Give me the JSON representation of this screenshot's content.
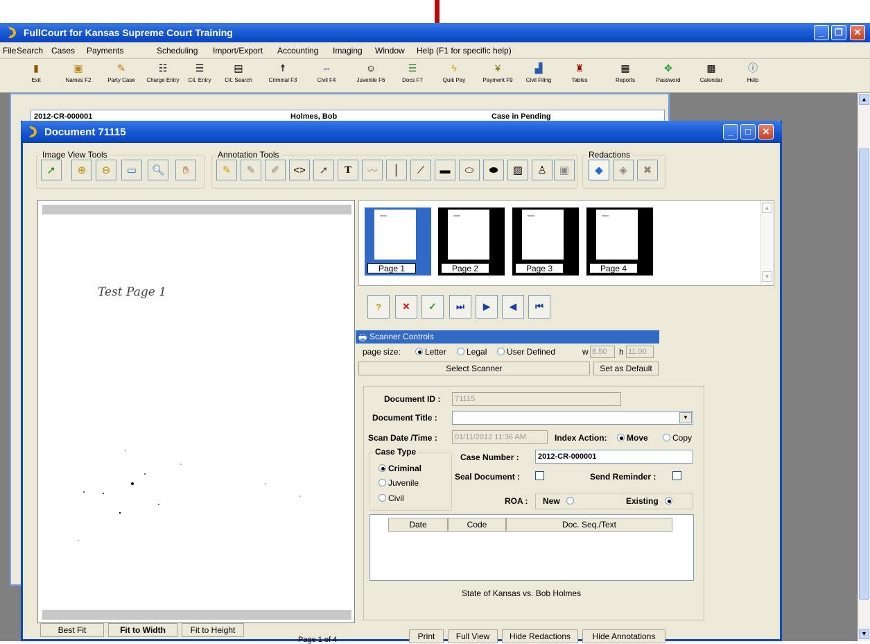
{
  "main_window": {
    "title": "FullCourt for Kansas Supreme Court Training",
    "controls": [
      "_",
      "❐",
      "✕"
    ]
  },
  "menu": {
    "items": [
      "File",
      "Search",
      "Cases",
      "Payments",
      "Scheduling",
      "Import/Export",
      "Accounting",
      "Imaging",
      "Window",
      "Help",
      "(F1 for specific help)"
    ]
  },
  "toolbar": {
    "items": [
      {
        "label": "Exit",
        "icon": "exit-icon"
      },
      {
        "label": "Names F2",
        "icon": "names-icon"
      },
      {
        "label": "Party Case",
        "icon": "party-case-icon"
      },
      {
        "label": "Charge Entry",
        "icon": "charge-entry-icon"
      },
      {
        "label": "Cit. Entry",
        "icon": "cit-entry-icon"
      },
      {
        "label": "Cit. Search",
        "icon": "cit-search-icon"
      },
      {
        "label": "Criminal F3",
        "icon": "criminal-icon"
      },
      {
        "label": "Civil F4",
        "icon": "civil-icon"
      },
      {
        "label": "Juvenile F6",
        "icon": "juvenile-icon"
      },
      {
        "label": "Docs F7",
        "icon": "docs-icon"
      },
      {
        "label": "Quik Pay",
        "icon": "quik-pay-icon"
      },
      {
        "label": "Payment F9",
        "icon": "payment-icon"
      },
      {
        "label": "Civil Filing",
        "icon": "civil-filing-icon"
      },
      {
        "label": "Tables",
        "icon": "tables-icon"
      },
      {
        "label": "Reports",
        "icon": "reports-icon"
      },
      {
        "label": "Password",
        "icon": "password-icon"
      },
      {
        "label": "Calendar",
        "icon": "calendar-icon"
      },
      {
        "label": "Help",
        "icon": "help-icon"
      }
    ]
  },
  "background_window": {
    "case_line": "2012-CR-000001",
    "name_line": "Holmes, Bob",
    "status_line": "Case in Pending"
  },
  "document_window": {
    "title": "Document 71115",
    "groups": {
      "image_view_tools": "Image View Tools",
      "annotation_tools": "Annotation Tools",
      "redactions": "Redactions"
    }
  },
  "viewer": {
    "handwritten_text": "Test Page 1",
    "buttons": [
      "Best Fit",
      "Fit to Width",
      "Fit to Height"
    ],
    "page_indicator": "Page 1 of 4"
  },
  "thumbnails": {
    "pages": [
      "Page 1",
      "Page 2",
      "Page 3",
      "Page 4"
    ],
    "selected": "Page 1"
  },
  "scanner": {
    "header": "Scanner Controls",
    "page_size_label": "page size:",
    "options": [
      "Letter",
      "Legal",
      "User Defined"
    ],
    "selected": "Letter",
    "w_label": "w",
    "w_value": "8.50",
    "h_label": "h",
    "h_value": "11.00",
    "select_scanner": "Select Scanner",
    "set_default": "Set as Default"
  },
  "form": {
    "document_id_label": "Document ID :",
    "document_id": "71115",
    "document_title_label": "Document Title :",
    "document_title": "",
    "scan_date_label": "Scan Date /Time :",
    "scan_date": "01/11/2012 11:36 AM",
    "index_action_label": "Index Action:",
    "index_move": "Move",
    "index_copy": "Copy",
    "case_type_label": "Case Type",
    "case_types": [
      "Criminal",
      "Juvenile",
      "Civil"
    ],
    "case_type_selected": "Criminal",
    "case_number_label": "Case Number :",
    "case_number": "2012-CR-000001",
    "seal_label": "Seal Document :",
    "send_reminder_label": "Send Reminder :",
    "roa_label": "ROA :",
    "roa_new": "New",
    "roa_existing": "Existing",
    "grid_headers": [
      "Date",
      "Code",
      "Doc. Seq./Text"
    ],
    "caption": "State of Kansas  vs.  Bob Holmes"
  },
  "bottom_buttons": [
    "Print",
    "Full View",
    "Hide Redactions",
    "Hide Annotations"
  ],
  "colors": {
    "title_bar": "#0a47c4",
    "arrow": "#b50d0d",
    "selected_thumb": "#316ac5",
    "window_bg": "#ece9d8"
  }
}
